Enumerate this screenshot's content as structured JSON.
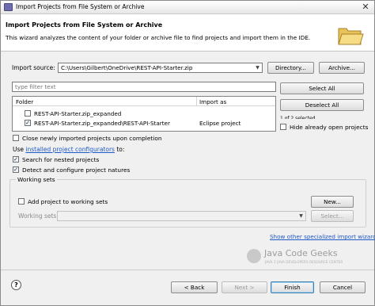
{
  "window": {
    "title": "Import Projects from File System or Archive",
    "close_glyph": "✕"
  },
  "header": {
    "title": "Import Projects from File System or Archive",
    "description": "This wizard analyzes the content of your folder or archive file to find projects and import them in the IDE."
  },
  "import_source": {
    "label": "Import source:",
    "value": "C:\\Users\\Gilbert\\OneDrive\\REST-API-Starter.zip",
    "directory_button": "Directory...",
    "archive_button": "Archive..."
  },
  "filter": {
    "placeholder": "type filter text"
  },
  "table": {
    "columns": [
      "Folder",
      "Import as"
    ],
    "rows": [
      {
        "folder": "REST-API-Starter.zip_expanded",
        "import_as": "",
        "checked": false
      },
      {
        "folder": "REST-API-Starter.zip_expanded\\REST-API-Starter",
        "import_as": "Eclipse project",
        "checked": true
      }
    ]
  },
  "side": {
    "select_all": "Select All",
    "deselect_all": "Deselect All",
    "selected_count": "1 of 2 selected",
    "hide_open_projects": "Hide already open projects"
  },
  "options": {
    "close_newly_imported": "Close newly imported projects upon completion",
    "use_prefix": "Use",
    "configurators_link": "installed project configurators",
    "use_suffix": "to:",
    "search_nested": "Search for nested projects",
    "detect_configure": "Detect and configure project natures"
  },
  "working_sets": {
    "group_title": "Working sets",
    "add_to_working_sets": "Add project to working sets",
    "new_button": "New...",
    "working_sets_label": "Working sets:",
    "select_button": "Select..."
  },
  "show_other_wizards": "Show other specialized import wizards",
  "watermark": {
    "text": "Java Code Geeks",
    "sub": "JAVA 2 JAVA DEVELOPERS RESOURCE CENTER"
  },
  "footer": {
    "help_glyph": "?",
    "back": "< Back",
    "next": "Next >",
    "finish": "Finish",
    "cancel": "Cancel"
  }
}
